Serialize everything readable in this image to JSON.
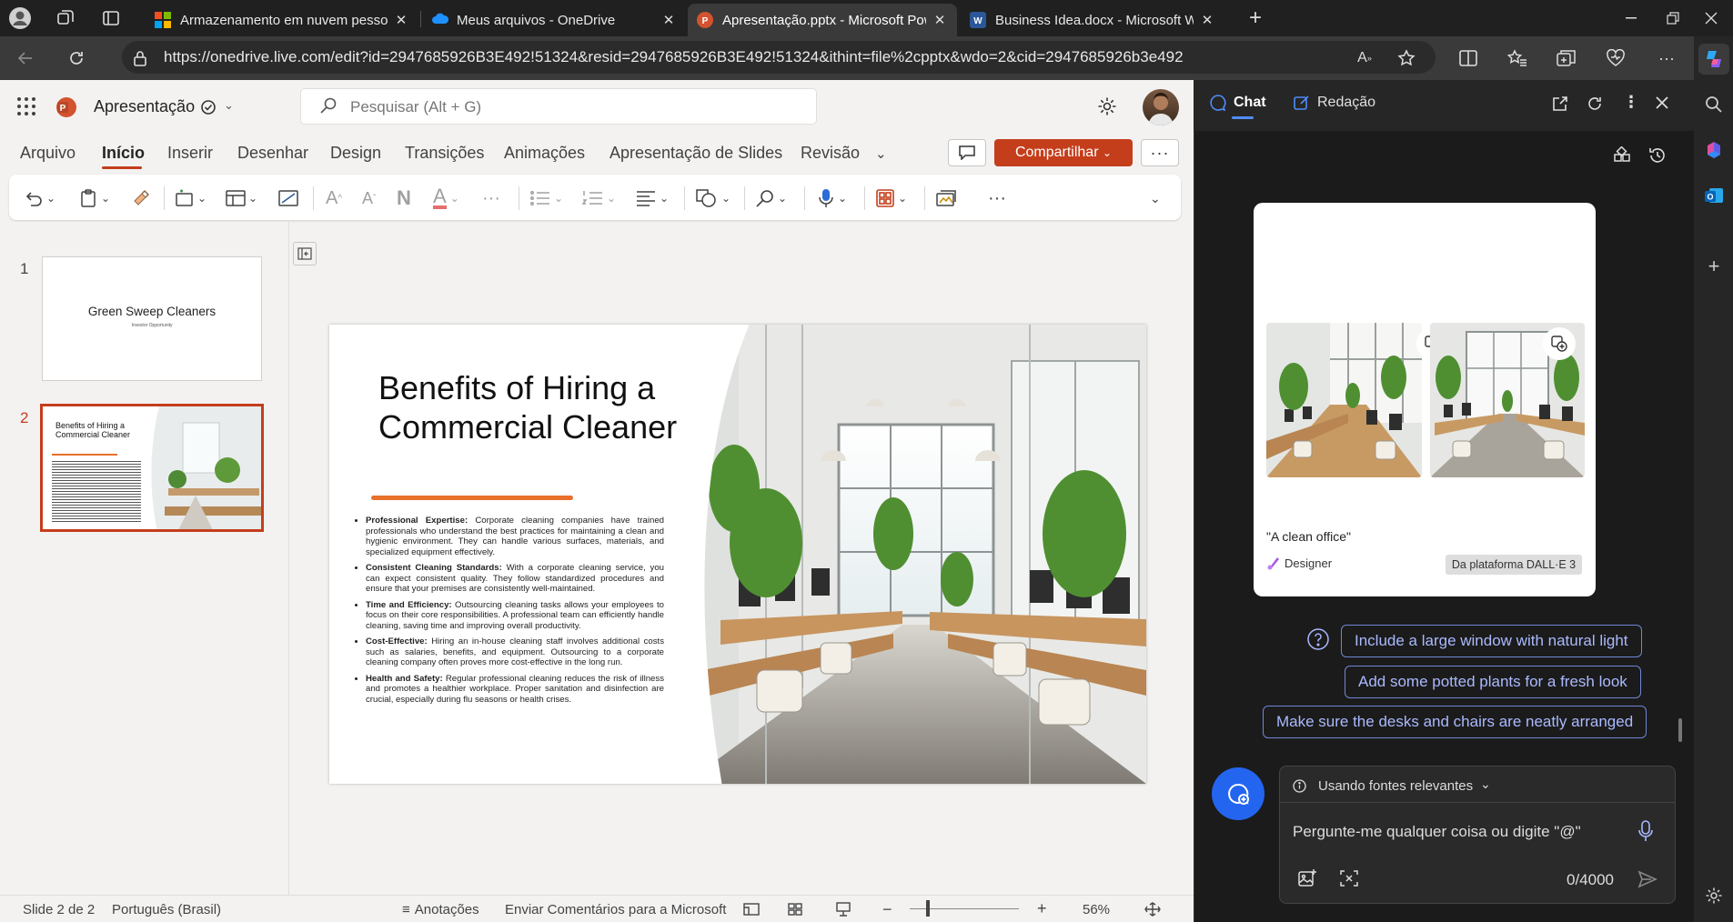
{
  "browser": {
    "tabs": [
      {
        "title": "Armazenamento em nuvem pessoal",
        "icon": "microsoft-logo-icon",
        "active": false
      },
      {
        "title": "Meus arquivos - OneDrive",
        "icon": "onedrive-cloud-icon",
        "active": false
      },
      {
        "title": "Apresentação.pptx - Microsoft PowerPoint",
        "icon": "powerpoint-icon",
        "active": true
      },
      {
        "title": "Business Idea.docx - Microsoft Word",
        "icon": "word-icon",
        "active": false
      }
    ],
    "url": "https://onedrive.live.com/edit?id=2947685926B3E492!51324&resid=2947685926B3E492!51324&ithint=file%2cpptx&wdo=2&cid=2947685926b3e492"
  },
  "powerpoint": {
    "file_name": "Apresentação",
    "search_placeholder": "Pesquisar (Alt + G)",
    "ribbon_tabs": [
      "Arquivo",
      "Início",
      "Inserir",
      "Desenhar",
      "Design",
      "Transições",
      "Animações",
      "Apresentação de Slides",
      "Revisão"
    ],
    "active_tab": "Início",
    "share_label": "Compartilhar",
    "thumbnails": [
      {
        "number": "1",
        "title": "Green Sweep Cleaners",
        "subtitle": "Investor Opportunity"
      },
      {
        "number": "2",
        "title": "Benefits of Hiring a Commercial Cleaner"
      }
    ],
    "slide": {
      "title": "Benefits of Hiring a Commercial Cleaner",
      "bullets": [
        {
          "heading": "Professional Expertise:",
          "text": "Corporate cleaning companies have trained professionals who understand the best practices for maintaining a clean and hygienic environment. They can handle various surfaces, materials, and specialized equipment effectively."
        },
        {
          "heading": "Consistent Cleaning Standards:",
          "text": "With a corporate cleaning service, you can expect consistent quality. They follow standardized procedures and ensure that your premises are consistently well-maintained."
        },
        {
          "heading": "Time and Efficiency:",
          "text": "Outsourcing cleaning tasks allows your employees to focus on their core responsibilities. A professional team can efficiently handle cleaning, saving time and improving overall productivity."
        },
        {
          "heading": "Cost-Effective:",
          "text": "Hiring an in-house cleaning staff involves additional costs such as salaries, benefits, and equipment. Outsourcing to a corporate cleaning company often proves more cost-effective in the long run."
        },
        {
          "heading": "Health and Safety:",
          "text": "Regular professional cleaning reduces the risk of illness and promotes a healthier workplace. Proper sanitation and disinfection are crucial, especially during flu seasons or health crises."
        }
      ]
    },
    "status": {
      "slide_count": "Slide 2 de 2",
      "language": "Português (Brasil)",
      "notes": "Anotações",
      "feedback": "Enviar Comentários para a Microsoft",
      "zoom": "56%"
    }
  },
  "copilot": {
    "tabs": [
      "Chat",
      "Redação"
    ],
    "active_tab": "Chat",
    "image_prompt": "\"A clean office\"",
    "designer_label": "Designer",
    "platform_badge": "Da plataforma DALL·E 3",
    "suggestions": [
      "Include a large window with natural light",
      "Add some potted plants for a fresh look",
      "Make sure the desks and chairs are neatly arranged"
    ],
    "sources_label": "Usando fontes relevantes",
    "input_placeholder": "Pergunte-me qualquer coisa ou digite \"@\"",
    "char_counter": "0/4000"
  },
  "colors": {
    "ppt_accent": "#c43e1c",
    "slide_underline": "#e8702a",
    "copilot_blue": "#2465f0",
    "suggestion_text": "#aab9ff"
  }
}
